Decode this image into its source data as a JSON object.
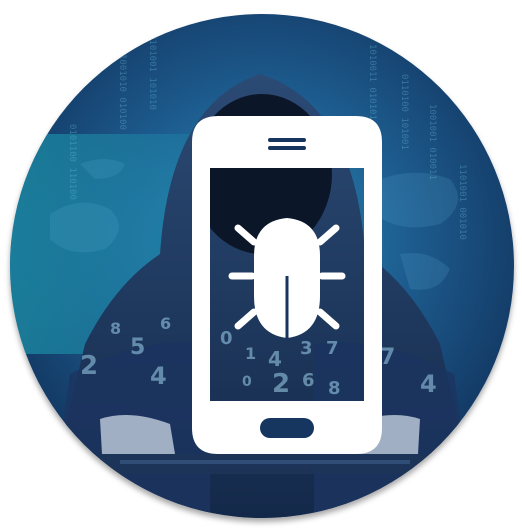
{
  "image": {
    "subject": "mobile-malware-badge",
    "icons": {
      "phone": "smartphone-icon",
      "bug": "bug-icon",
      "figure": "hooded-hacker-figure",
      "keyboard": "keyboard"
    },
    "colors": {
      "background_deep": "#0f2a52",
      "background_mid": "#1d5c8f",
      "background_teal": "#1f9db3",
      "hoodie": "#203a5e",
      "phone_frame": "#ffffff",
      "bug": "#ffffff",
      "rim": "#c9d2dc"
    }
  }
}
